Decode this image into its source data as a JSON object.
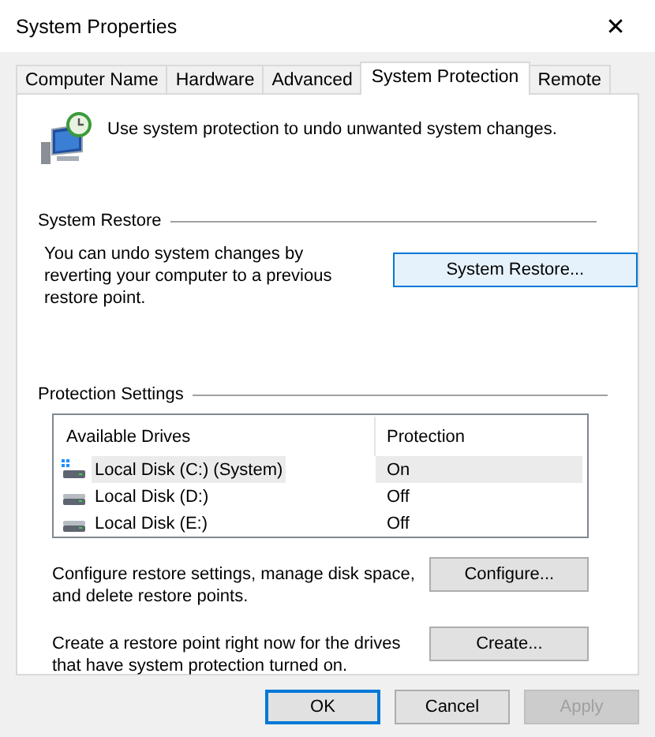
{
  "window": {
    "title": "System Properties",
    "close": "✕"
  },
  "tabs": [
    {
      "label": "Computer Name",
      "selected": false
    },
    {
      "label": "Hardware",
      "selected": false
    },
    {
      "label": "Advanced",
      "selected": false
    },
    {
      "label": "System Protection",
      "selected": true
    },
    {
      "label": "Remote",
      "selected": false
    }
  ],
  "intro": "Use system protection to undo unwanted system changes.",
  "system_restore": {
    "heading": "System Restore",
    "text": "You can undo system changes by reverting your computer to a previous restore point.",
    "button": "System Restore..."
  },
  "protection_settings": {
    "heading": "Protection Settings",
    "columns": [
      "Available Drives",
      "Protection"
    ],
    "rows": [
      {
        "drive": "Local Disk (C:) (System)",
        "protection": "On",
        "kind": "system",
        "selected": true
      },
      {
        "drive": "Local Disk (D:)",
        "protection": "Off",
        "kind": "disk",
        "selected": false
      },
      {
        "drive": "Local Disk (E:)",
        "protection": "Off",
        "kind": "disk",
        "selected": false
      }
    ],
    "actions": [
      {
        "text": "Configure restore settings, manage disk space, and delete restore points.",
        "button": "Configure..."
      },
      {
        "text": "Create a restore point right now for the drives that have system protection turned on.",
        "button": "Create..."
      }
    ]
  },
  "buttons": [
    {
      "label": "OK",
      "default": true,
      "disabled": false
    },
    {
      "label": "Cancel",
      "default": false,
      "disabled": false
    },
    {
      "label": "Apply",
      "default": false,
      "disabled": true
    }
  ]
}
